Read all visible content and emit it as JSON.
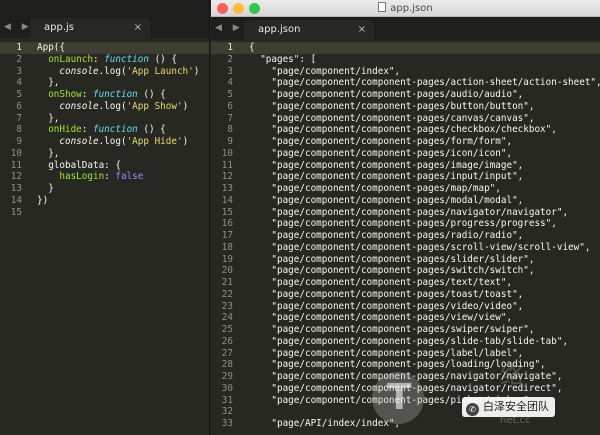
{
  "left_editor": {
    "tab_label": "app.js",
    "close_glyph": "×",
    "nav_glyph": "◀ ▶",
    "lines": [
      [
        {
          "t": "App({",
          "c": "k-id"
        }
      ],
      [
        {
          "t": "  onLaunch",
          "c": "k-prop"
        },
        {
          "t": ": ",
          "c": "k-punc"
        },
        {
          "t": "function",
          "c": "k-fn"
        },
        {
          "t": " () {",
          "c": "k-punc"
        }
      ],
      [
        {
          "t": "    console",
          "c": "k-ital"
        },
        {
          "t": ".log(",
          "c": "k-punc"
        },
        {
          "t": "'App Launch'",
          "c": "k-str"
        },
        {
          "t": ")",
          "c": "k-punc"
        }
      ],
      [
        {
          "t": "  },",
          "c": "k-punc"
        }
      ],
      [
        {
          "t": "  onShow",
          "c": "k-prop"
        },
        {
          "t": ": ",
          "c": "k-punc"
        },
        {
          "t": "function",
          "c": "k-fn"
        },
        {
          "t": " () {",
          "c": "k-punc"
        }
      ],
      [
        {
          "t": "    console",
          "c": "k-ital"
        },
        {
          "t": ".log(",
          "c": "k-punc"
        },
        {
          "t": "'App Show'",
          "c": "k-str"
        },
        {
          "t": ")",
          "c": "k-punc"
        }
      ],
      [
        {
          "t": "  },",
          "c": "k-punc"
        }
      ],
      [
        {
          "t": "  onHide",
          "c": "k-prop"
        },
        {
          "t": ": ",
          "c": "k-punc"
        },
        {
          "t": "function",
          "c": "k-fn"
        },
        {
          "t": " () {",
          "c": "k-punc"
        }
      ],
      [
        {
          "t": "    console",
          "c": "k-ital"
        },
        {
          "t": ".log(",
          "c": "k-punc"
        },
        {
          "t": "'App Hide'",
          "c": "k-str"
        },
        {
          "t": ")",
          "c": "k-punc"
        }
      ],
      [
        {
          "t": "  },",
          "c": "k-punc"
        }
      ],
      [
        {
          "t": "  globalData",
          "c": "k-id"
        },
        {
          "t": ": {",
          "c": "k-punc"
        }
      ],
      [
        {
          "t": "    hasLogin",
          "c": "k-prop"
        },
        {
          "t": ": ",
          "c": "k-punc"
        },
        {
          "t": "false",
          "c": "k-bool"
        }
      ],
      [
        {
          "t": "  }",
          "c": "k-punc"
        }
      ],
      [
        {
          "t": "})",
          "c": "k-punc"
        }
      ],
      []
    ],
    "current_line": 1
  },
  "right_editor": {
    "window_title": "app.json",
    "tab_label": "app.json",
    "close_glyph": "×",
    "nav_glyph": "◀ ▶",
    "lines": [
      [
        {
          "t": "{",
          "c": "k-punc"
        }
      ],
      [
        {
          "t": "  \"pages\": [",
          "c": "k-punc"
        }
      ],
      [
        {
          "t": "    \"page/component/index\",",
          "c": "k-punc"
        }
      ],
      [
        {
          "t": "    \"page/component/component-pages/action-sheet/action-sheet\",",
          "c": "k-punc"
        }
      ],
      [
        {
          "t": "    \"page/component/component-pages/audio/audio\",",
          "c": "k-punc"
        }
      ],
      [
        {
          "t": "    \"page/component/component-pages/button/button\",",
          "c": "k-punc"
        }
      ],
      [
        {
          "t": "    \"page/component/component-pages/canvas/canvas\",",
          "c": "k-punc"
        }
      ],
      [
        {
          "t": "    \"page/component/component-pages/checkbox/checkbox\",",
          "c": "k-punc"
        }
      ],
      [
        {
          "t": "    \"page/component/component-pages/form/form\",",
          "c": "k-punc"
        }
      ],
      [
        {
          "t": "    \"page/component/component-pages/icon/icon\",",
          "c": "k-punc"
        }
      ],
      [
        {
          "t": "    \"page/component/component-pages/image/image\",",
          "c": "k-punc"
        }
      ],
      [
        {
          "t": "    \"page/component/component-pages/input/input\",",
          "c": "k-punc"
        }
      ],
      [
        {
          "t": "    \"page/component/component-pages/map/map\",",
          "c": "k-punc"
        }
      ],
      [
        {
          "t": "    \"page/component/component-pages/modal/modal\",",
          "c": "k-punc"
        }
      ],
      [
        {
          "t": "    \"page/component/component-pages/navigator/navigator\",",
          "c": "k-punc"
        }
      ],
      [
        {
          "t": "    \"page/component/component-pages/progress/progress\",",
          "c": "k-punc"
        }
      ],
      [
        {
          "t": "    \"page/component/component-pages/radio/radio\",",
          "c": "k-punc"
        }
      ],
      [
        {
          "t": "    \"page/component/component-pages/scroll-view/scroll-view\",",
          "c": "k-punc"
        }
      ],
      [
        {
          "t": "    \"page/component/component-pages/slider/slider\",",
          "c": "k-punc"
        }
      ],
      [
        {
          "t": "    \"page/component/component-pages/switch/switch\",",
          "c": "k-punc"
        }
      ],
      [
        {
          "t": "    \"page/component/component-pages/text/text\",",
          "c": "k-punc"
        }
      ],
      [
        {
          "t": "    \"page/component/component-pages/toast/toast\",",
          "c": "k-punc"
        }
      ],
      [
        {
          "t": "    \"page/component/component-pages/video/video\",",
          "c": "k-punc"
        }
      ],
      [
        {
          "t": "    \"page/component/component-pages/view/view\",",
          "c": "k-punc"
        }
      ],
      [
        {
          "t": "    \"page/component/component-pages/swiper/swiper\",",
          "c": "k-punc"
        }
      ],
      [
        {
          "t": "    \"page/component/component-pages/slide-tab/slide-tab\",",
          "c": "k-punc"
        }
      ],
      [
        {
          "t": "    \"page/component/component-pages/label/label\",",
          "c": "k-punc"
        }
      ],
      [
        {
          "t": "    \"page/component/component-pages/loading/loading\",",
          "c": "k-punc"
        }
      ],
      [
        {
          "t": "    \"page/component/component-pages/navigator/navigate\",",
          "c": "k-punc"
        }
      ],
      [
        {
          "t": "    \"page/component/component-pages/navigator/redirect\",",
          "c": "k-punc"
        }
      ],
      [
        {
          "t": "    \"page/component/component-pages/picker/picker\",",
          "c": "k-punc"
        }
      ],
      [],
      [
        {
          "t": "    \"page/API/index/index\",",
          "c": "k-punc"
        }
      ]
    ],
    "current_line": 1
  },
  "watermark": {
    "badge_text": "白泽安全团队",
    "wechat_glyph": "✆",
    "big_text": "络",
    "url_text": "net.cc"
  },
  "colors": {
    "background": "#272822",
    "traffic_red": "#fc605c",
    "traffic_yellow": "#fdbc40",
    "traffic_green": "#34c84a"
  }
}
